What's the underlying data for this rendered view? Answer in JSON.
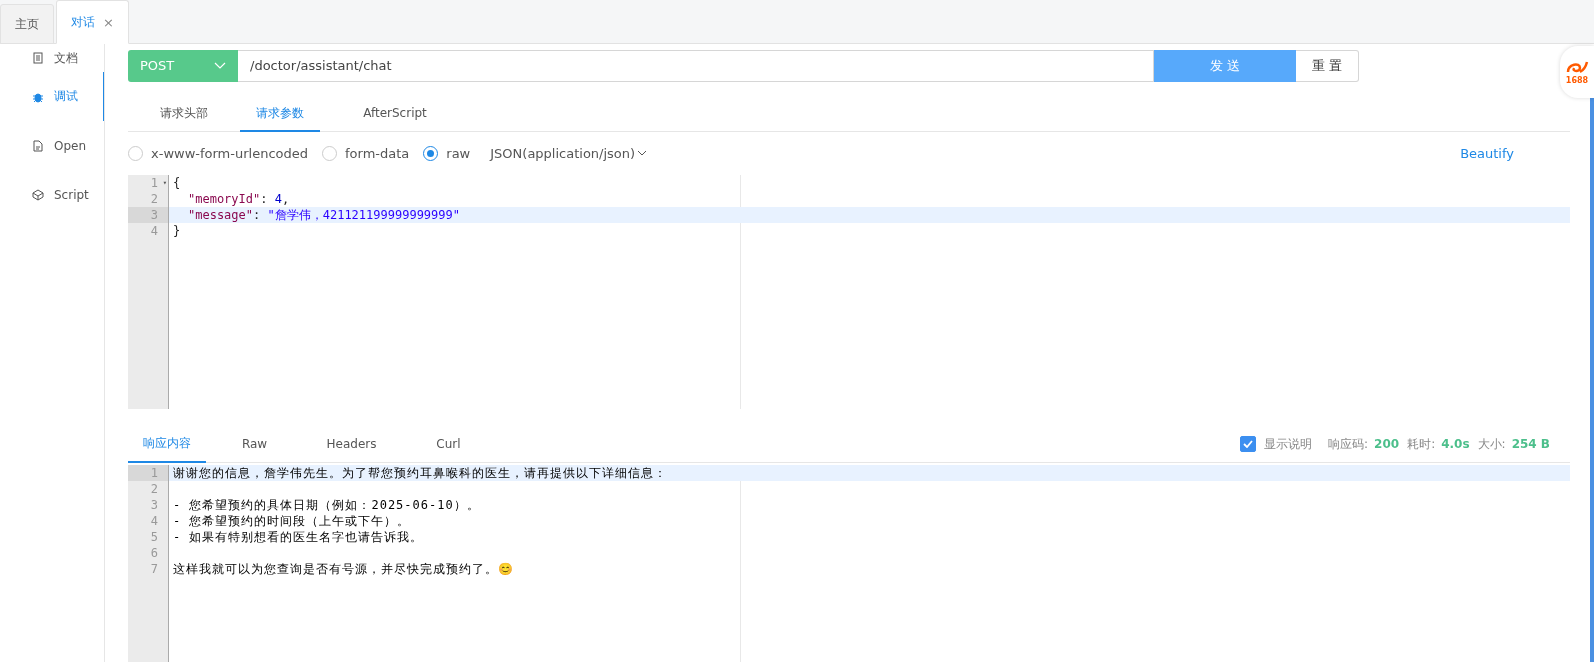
{
  "page_tabs": [
    {
      "label": "主页",
      "selected": false
    },
    {
      "label": "对话",
      "selected": true,
      "close": "×"
    }
  ],
  "sidebar": {
    "items": [
      {
        "label": "文档",
        "kind": "doc",
        "selected": false
      },
      {
        "label": "调试",
        "kind": "bug",
        "selected": true
      },
      {
        "label": "Open",
        "kind": "file",
        "selected": false
      },
      {
        "label": "Script",
        "kind": "cube",
        "selected": false
      }
    ]
  },
  "request": {
    "method": "POST",
    "url": "/doctor/assistant/chat",
    "send": "发 送",
    "reset": "重 置"
  },
  "request_tabs": [
    {
      "label": "请求头部",
      "selected": false
    },
    {
      "label": "请求参数",
      "selected": true
    },
    {
      "label": "AfterScript",
      "selected": false
    }
  ],
  "body_types": [
    {
      "label": "x-www-form-urlencoded",
      "selected": false
    },
    {
      "label": "form-data",
      "selected": false
    },
    {
      "label": "raw",
      "selected": true
    }
  ],
  "content_type": "JSON(application/json)",
  "beautify": "Beautify",
  "request_editor": {
    "lines": [
      {
        "number": "1",
        "fold_mark": "▾",
        "active": false,
        "indented": false,
        "tokens": [
          {
            "kind": "punct",
            "text": "{"
          }
        ]
      },
      {
        "number": "2",
        "active": false,
        "indented": true,
        "tokens": [
          {
            "kind": "key",
            "text": "\"memoryId\""
          },
          {
            "kind": "punct",
            "text": ": "
          },
          {
            "kind": "number",
            "text": "4"
          },
          {
            "kind": "punct",
            "text": ","
          }
        ]
      },
      {
        "number": "3",
        "active": true,
        "indented": true,
        "tokens": [
          {
            "kind": "key",
            "text": "\"message\""
          },
          {
            "kind": "punct",
            "text": ": "
          },
          {
            "kind": "string",
            "text": "\"詹学伟，421121199999999999\""
          }
        ]
      },
      {
        "number": "4",
        "active": false,
        "indented": false,
        "tokens": [
          {
            "kind": "punct",
            "text": "}"
          }
        ]
      }
    ]
  },
  "response_tabs": [
    {
      "label": "响应内容",
      "selected": true
    },
    {
      "label": "Raw",
      "selected": false
    },
    {
      "label": "Headers",
      "selected": false
    },
    {
      "label": "Curl",
      "selected": false
    }
  ],
  "show_description": {
    "label": "显示说明",
    "checked": true
  },
  "response_stats": [
    {
      "label": "响应码:",
      "value": "200"
    },
    {
      "label": "耗时:",
      "value": "4.0s"
    },
    {
      "label": "大小:",
      "value": "254 B"
    }
  ],
  "response_editor": {
    "lines": [
      {
        "number": "1",
        "active": true,
        "text": "谢谢您的信息，詹学伟先生。为了帮您预约耳鼻喉科的医生，请再提供以下详细信息："
      },
      {
        "number": "2",
        "active": false
      },
      {
        "number": "3",
        "active": false,
        "text": "- 您希望预约的具体日期（例如：2025-06-10）。"
      },
      {
        "number": "4",
        "active": false,
        "text": "- 您希望预约的时间段（上午或下午）。"
      },
      {
        "number": "5",
        "active": false,
        "text": "- 如果有特别想看的医生名字也请告诉我。"
      },
      {
        "number": "6",
        "active": false
      },
      {
        "number": "7",
        "active": false,
        "text": "这样我就可以为您查询是否有号源，并尽快完成预约了。😊"
      }
    ]
  },
  "extension_badge": {
    "text": "1688"
  }
}
